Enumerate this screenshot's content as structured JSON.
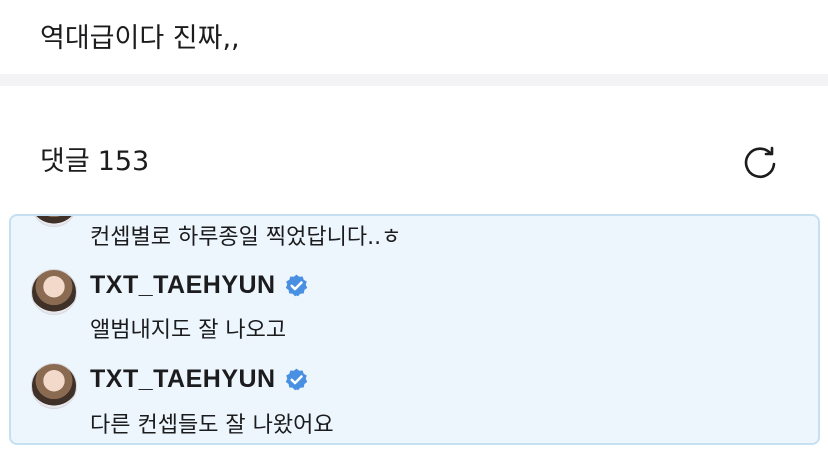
{
  "post": {
    "text": "역대급이다 진짜,,"
  },
  "comments": {
    "title": "댓글",
    "count": "153",
    "thread": [
      {
        "text": "컨셉별로 하루종일 찍었답니다..ㅎ"
      },
      {
        "username": "TXT_TAEHYUN",
        "text": "앨범내지도 잘 나오고"
      },
      {
        "username": "TXT_TAEHYUN",
        "text": "다른 컨셉들도 잘 나왔어요"
      }
    ]
  },
  "icons": {
    "refresh": "refresh-icon",
    "verified": "verified-badge-icon",
    "avatar": "avatar"
  },
  "colors": {
    "highlight_bg": "#ecf6fc",
    "highlight_border": "#c5e1f1",
    "verified": "#4a90e2",
    "divider": "#f3f3f6"
  }
}
